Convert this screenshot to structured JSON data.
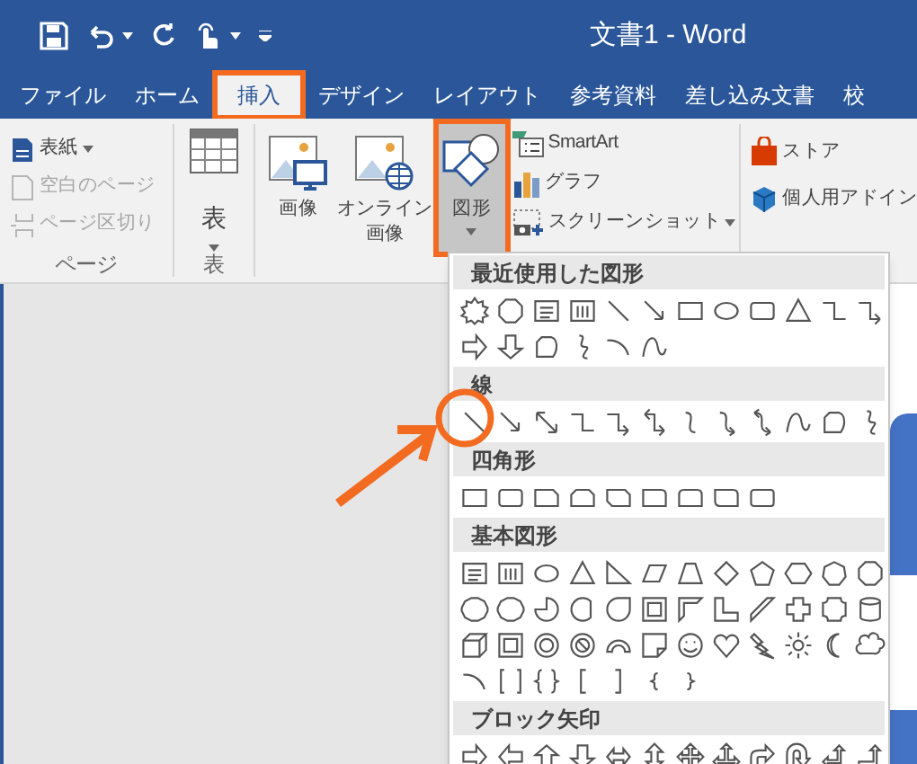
{
  "title_bar": {
    "title": "文書1 - Word"
  },
  "tabs": [
    {
      "label": "ファイル",
      "selected": false,
      "highlighted": false
    },
    {
      "label": "ホーム",
      "selected": false,
      "highlighted": false
    },
    {
      "label": "挿入",
      "selected": true,
      "highlighted": true
    },
    {
      "label": "デザイン",
      "selected": false,
      "highlighted": false
    },
    {
      "label": "レイアウト",
      "selected": false,
      "highlighted": false
    },
    {
      "label": "参考資料",
      "selected": false,
      "highlighted": false
    },
    {
      "label": "差し込み文書",
      "selected": false,
      "highlighted": false
    },
    {
      "label": "校",
      "selected": false,
      "highlighted": false
    }
  ],
  "page_group": {
    "label": "ページ",
    "items": [
      {
        "label": "表紙",
        "kind": "dropdown",
        "disabled": false
      },
      {
        "label": "空白のページ",
        "kind": "button",
        "disabled": true
      },
      {
        "label": "ページ区切り",
        "kind": "button",
        "disabled": true
      }
    ]
  },
  "table_group": {
    "label": "表",
    "button": "表"
  },
  "illustrations": {
    "large_buttons": [
      {
        "kind": "picture",
        "lines": [
          "画像"
        ],
        "pressed": false,
        "highlighted": false
      },
      {
        "kind": "online",
        "lines": [
          "オンライン",
          "画像"
        ],
        "pressed": false,
        "highlighted": false
      },
      {
        "kind": "shapes",
        "lines": [
          "図形"
        ],
        "pressed": true,
        "highlighted": true
      }
    ],
    "small_buttons": [
      {
        "kind": "smartart",
        "label": "SmartArt"
      },
      {
        "kind": "chart",
        "label": "グラフ"
      },
      {
        "kind": "screenshot",
        "label": "スクリーンショット"
      }
    ]
  },
  "addins": [
    {
      "kind": "store",
      "label": "ストア"
    },
    {
      "kind": "personal",
      "label": "個人用アドイン"
    }
  ],
  "shapes_menu": {
    "sections": [
      {
        "kind": "recent",
        "title": "最近使用した図形"
      },
      {
        "kind": "lines",
        "title": "線"
      },
      {
        "kind": "rectangles",
        "title": "四角形"
      },
      {
        "kind": "basic",
        "title": "基本図形"
      },
      {
        "kind": "block_arrows",
        "title": "ブロック矢印"
      }
    ]
  }
}
